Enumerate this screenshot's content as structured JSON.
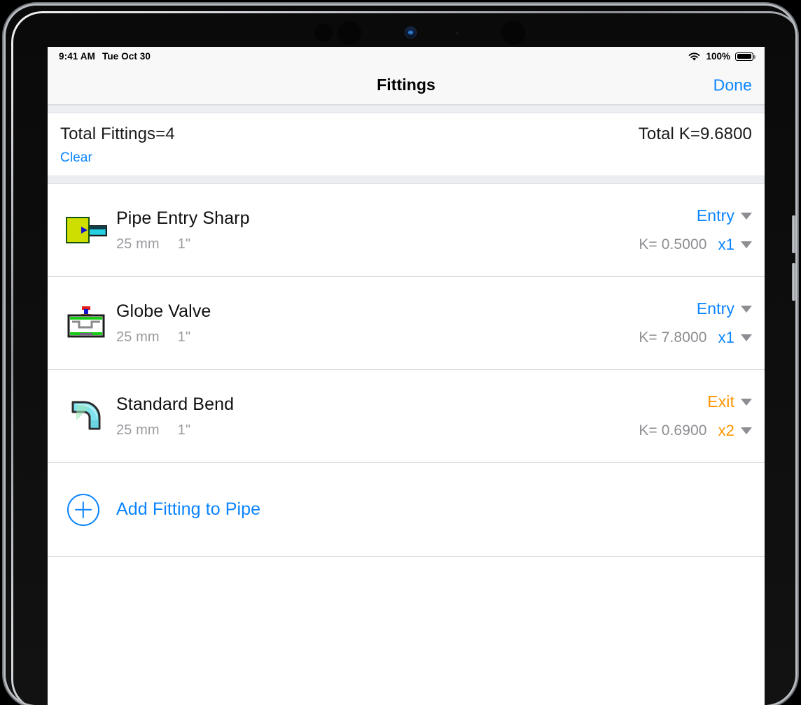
{
  "status_bar": {
    "time": "9:41 AM",
    "date": "Tue Oct 30",
    "battery_percent": "100%",
    "wifi_icon": "wifi-icon",
    "battery_icon": "battery-full-icon"
  },
  "nav_bar": {
    "title": "Fittings",
    "done_label": "Done"
  },
  "summary": {
    "total_fittings": "Total Fittings=4",
    "total_k": "Total K=9.6800",
    "clear_label": "Clear"
  },
  "colors": {
    "accent_blue": "#0a84ff",
    "accent_orange": "#ff9500",
    "muted_gray": "#8d8d92",
    "section_band": "#eceef2"
  },
  "fittings": [
    {
      "name": "Pipe Entry Sharp",
      "size_metric": "25 mm",
      "size_imperial": "1\"",
      "k_value": "K= 0.5000",
      "position_label": "Entry",
      "position_color": "blue",
      "count_label": "x1",
      "count_color": "blue",
      "icon": "pipe-entry-sharp-icon"
    },
    {
      "name": "Globe Valve",
      "size_metric": "25 mm",
      "size_imperial": "1\"",
      "k_value": "K= 7.8000",
      "position_label": "Entry",
      "position_color": "blue",
      "count_label": "x1",
      "count_color": "blue",
      "icon": "globe-valve-icon"
    },
    {
      "name": "Standard Bend",
      "size_metric": "25 mm",
      "size_imperial": "1\"",
      "k_value": "K= 0.6900",
      "position_label": "Exit",
      "position_color": "orange",
      "count_label": "x2",
      "count_color": "orange",
      "icon": "standard-bend-icon"
    }
  ],
  "add_action": {
    "label": "Add Fitting to Pipe",
    "icon": "plus-circle-icon"
  }
}
